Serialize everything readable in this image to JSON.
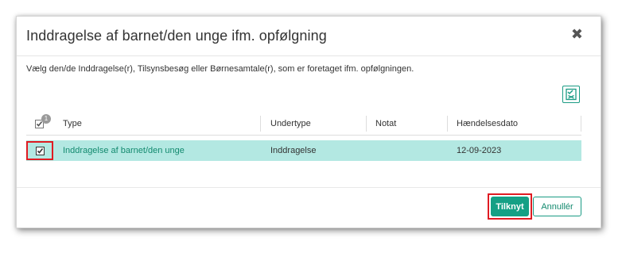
{
  "dialog": {
    "title": "Inddragelse af barnet/den unge ifm. opfølgning",
    "close_symbol": "✖",
    "instruction": "Vælg den/de Inddragelse(r), Tilsynsbesøg eller Børnesamtale(r), som er foretaget ifm. opfølgningen."
  },
  "toolbar": {
    "select_all_icon": "checklist-icon"
  },
  "table": {
    "selected_count": "1",
    "columns": [
      "Type",
      "Undertype",
      "Notat",
      "Hændelsesdato"
    ],
    "rows": [
      {
        "selected": true,
        "type": "Inddragelse af barnet/den unge",
        "undertype": "Inddragelse",
        "notat": "",
        "date": "12-09-2023"
      }
    ]
  },
  "buttons": {
    "confirm": "Tilknyt",
    "cancel": "Annullér"
  },
  "colors": {
    "accent": "#14a085",
    "row_highlight": "#b3e8e2",
    "link": "#138a6f",
    "highlight_frame": "#e01b22"
  }
}
